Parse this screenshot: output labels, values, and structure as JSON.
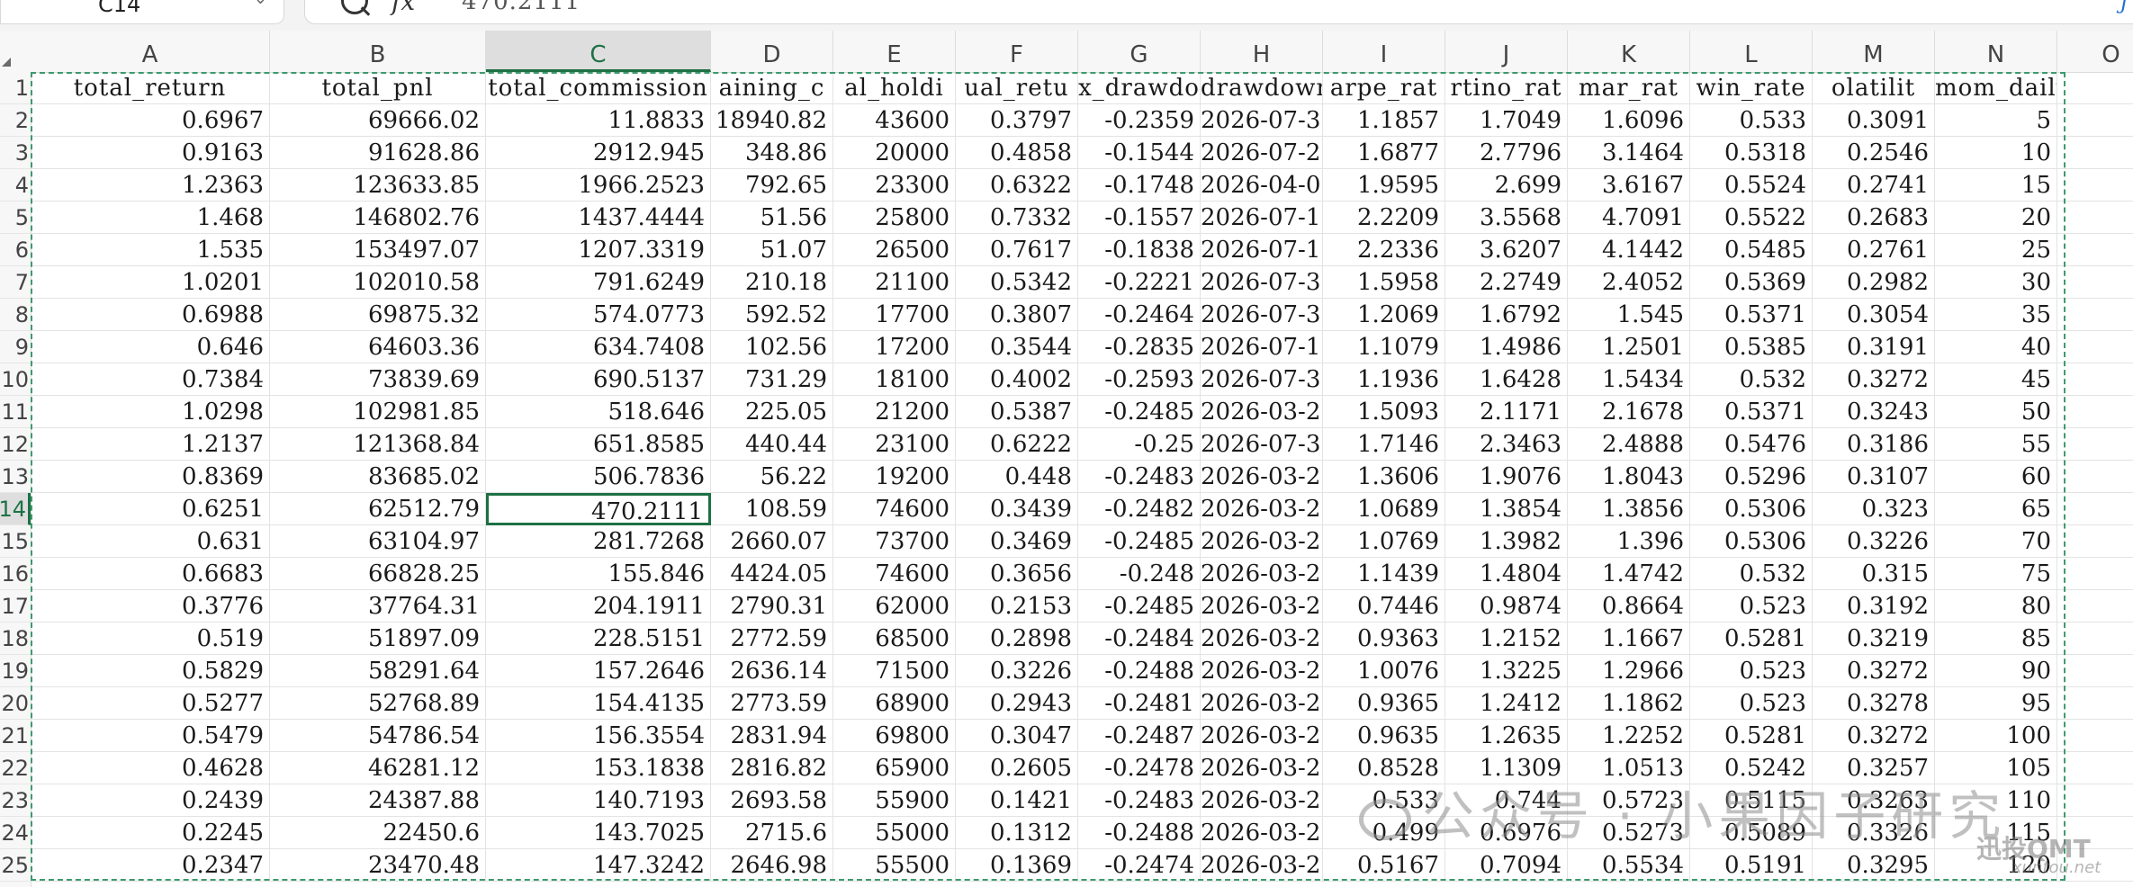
{
  "formula_bar": {
    "name_box": "C14",
    "fx_label": "fx",
    "value": "470.2111"
  },
  "columns": [
    "A",
    "B",
    "C",
    "D",
    "E",
    "F",
    "G",
    "H",
    "I",
    "J",
    "K",
    "L",
    "M",
    "N",
    "O"
  ],
  "headers": [
    "total_return",
    "total_pnl",
    "total_commission",
    "aining_c",
    "al_holdi",
    "ual_retu",
    "x_drawdo",
    "drawdown_",
    "arpe_rat",
    "rtino_rat",
    "mar_rat",
    "win_rate",
    "olatilit",
    "mom_daily"
  ],
  "rows": [
    [
      "0.6967",
      "69666.02",
      "11.8833",
      "18940.82",
      "43600",
      "0.3797",
      "-0.2359",
      "2026-07-3",
      "1.1857",
      "1.7049",
      "1.6096",
      "0.533",
      "0.3091",
      "5"
    ],
    [
      "0.9163",
      "91628.86",
      "2912.945",
      "348.86",
      "20000",
      "0.4858",
      "-0.1544",
      "2026-07-2",
      "1.6877",
      "2.7796",
      "3.1464",
      "0.5318",
      "0.2546",
      "10"
    ],
    [
      "1.2363",
      "123633.85",
      "1966.2523",
      "792.65",
      "23300",
      "0.6322",
      "-0.1748",
      "2026-04-0",
      "1.9595",
      "2.699",
      "3.6167",
      "0.5524",
      "0.2741",
      "15"
    ],
    [
      "1.468",
      "146802.76",
      "1437.4444",
      "51.56",
      "25800",
      "0.7332",
      "-0.1557",
      "2026-07-1",
      "2.2209",
      "3.5568",
      "4.7091",
      "0.5522",
      "0.2683",
      "20"
    ],
    [
      "1.535",
      "153497.07",
      "1207.3319",
      "51.07",
      "26500",
      "0.7617",
      "-0.1838",
      "2026-07-1",
      "2.2336",
      "3.6207",
      "4.1442",
      "0.5485",
      "0.2761",
      "25"
    ],
    [
      "1.0201",
      "102010.58",
      "791.6249",
      "210.18",
      "21100",
      "0.5342",
      "-0.2221",
      "2026-07-3",
      "1.5958",
      "2.2749",
      "2.4052",
      "0.5369",
      "0.2982",
      "30"
    ],
    [
      "0.6988",
      "69875.32",
      "574.0773",
      "592.52",
      "17700",
      "0.3807",
      "-0.2464",
      "2026-07-3",
      "1.2069",
      "1.6792",
      "1.545",
      "0.5371",
      "0.3054",
      "35"
    ],
    [
      "0.646",
      "64603.36",
      "634.7408",
      "102.56",
      "17200",
      "0.3544",
      "-0.2835",
      "2026-07-1",
      "1.1079",
      "1.4986",
      "1.2501",
      "0.5385",
      "0.3191",
      "40"
    ],
    [
      "0.7384",
      "73839.69",
      "690.5137",
      "731.29",
      "18100",
      "0.4002",
      "-0.2593",
      "2026-07-3",
      "1.1936",
      "1.6428",
      "1.5434",
      "0.532",
      "0.3272",
      "45"
    ],
    [
      "1.0298",
      "102981.85",
      "518.646",
      "225.05",
      "21200",
      "0.5387",
      "-0.2485",
      "2026-03-2",
      "1.5093",
      "2.1171",
      "2.1678",
      "0.5371",
      "0.3243",
      "50"
    ],
    [
      "1.2137",
      "121368.84",
      "651.8585",
      "440.44",
      "23100",
      "0.6222",
      "-0.25",
      "2026-07-3",
      "1.7146",
      "2.3463",
      "2.4888",
      "0.5476",
      "0.3186",
      "55"
    ],
    [
      "0.8369",
      "83685.02",
      "506.7836",
      "56.22",
      "19200",
      "0.448",
      "-0.2483",
      "2026-03-2",
      "1.3606",
      "1.9076",
      "1.8043",
      "0.5296",
      "0.3107",
      "60"
    ],
    [
      "0.6251",
      "62512.79",
      "470.2111",
      "108.59",
      "74600",
      "0.3439",
      "-0.2482",
      "2026-03-2",
      "1.0689",
      "1.3854",
      "1.3856",
      "0.5306",
      "0.323",
      "65"
    ],
    [
      "0.631",
      "63104.97",
      "281.7268",
      "2660.07",
      "73700",
      "0.3469",
      "-0.2485",
      "2026-03-2",
      "1.0769",
      "1.3982",
      "1.396",
      "0.5306",
      "0.3226",
      "70"
    ],
    [
      "0.6683",
      "66828.25",
      "155.846",
      "4424.05",
      "74600",
      "0.3656",
      "-0.248",
      "2026-03-2",
      "1.1439",
      "1.4804",
      "1.4742",
      "0.532",
      "0.315",
      "75"
    ],
    [
      "0.3776",
      "37764.31",
      "204.1911",
      "2790.31",
      "62000",
      "0.2153",
      "-0.2485",
      "2026-03-2",
      "0.7446",
      "0.9874",
      "0.8664",
      "0.523",
      "0.3192",
      "80"
    ],
    [
      "0.519",
      "51897.09",
      "228.5151",
      "2772.59",
      "68500",
      "0.2898",
      "-0.2484",
      "2026-03-2",
      "0.9363",
      "1.2152",
      "1.1667",
      "0.5281",
      "0.3219",
      "85"
    ],
    [
      "0.5829",
      "58291.64",
      "157.2646",
      "2636.14",
      "71500",
      "0.3226",
      "-0.2488",
      "2026-03-2",
      "1.0076",
      "1.3225",
      "1.2966",
      "0.523",
      "0.3272",
      "90"
    ],
    [
      "0.5277",
      "52768.89",
      "154.4135",
      "2773.59",
      "68900",
      "0.2943",
      "-0.2481",
      "2026-03-2",
      "0.9365",
      "1.2412",
      "1.1862",
      "0.523",
      "0.3278",
      "95"
    ],
    [
      "0.5479",
      "54786.54",
      "156.3554",
      "2831.94",
      "69800",
      "0.3047",
      "-0.2487",
      "2026-03-2",
      "0.9635",
      "1.2635",
      "1.2252",
      "0.5281",
      "0.3272",
      "100"
    ],
    [
      "0.4628",
      "46281.12",
      "153.1838",
      "2816.82",
      "65900",
      "0.2605",
      "-0.2478",
      "2026-03-2",
      "0.8528",
      "1.1309",
      "1.0513",
      "0.5242",
      "0.3257",
      "105"
    ],
    [
      "0.2439",
      "24387.88",
      "140.7193",
      "2693.58",
      "55900",
      "0.1421",
      "-0.2483",
      "2026-03-2",
      "0.533",
      "0.744",
      "0.5723",
      "0.5115",
      "0.3263",
      "110"
    ],
    [
      "0.2245",
      "22450.6",
      "143.7025",
      "2715.6",
      "55000",
      "0.1312",
      "-0.2488",
      "2026-03-2",
      "0.499",
      "0.6976",
      "0.5273",
      "0.5089",
      "0.3326",
      "115"
    ],
    [
      "0.2347",
      "23470.48",
      "147.3242",
      "2646.98",
      "55500",
      "0.1369",
      "-0.2474",
      "2026-03-2",
      "0.5167",
      "0.7094",
      "0.5534",
      "0.5191",
      "0.3295",
      "120"
    ]
  ],
  "row_numbers": [
    "1",
    "2",
    "3",
    "4",
    "5",
    "6",
    "7",
    "8",
    "9",
    "10",
    "11",
    "12",
    "13",
    "14",
    "15",
    "16",
    "17",
    "18",
    "19",
    "20",
    "21",
    "22",
    "23",
    "24",
    "25"
  ],
  "active_cell": "C14",
  "watermark": {
    "main": "公众号 · 小果因子研究",
    "brand": "迅投QMT",
    "site": "xuntou.net"
  },
  "colors": {
    "selection": "#1e7145",
    "copy_border": "#3e9a6d"
  }
}
